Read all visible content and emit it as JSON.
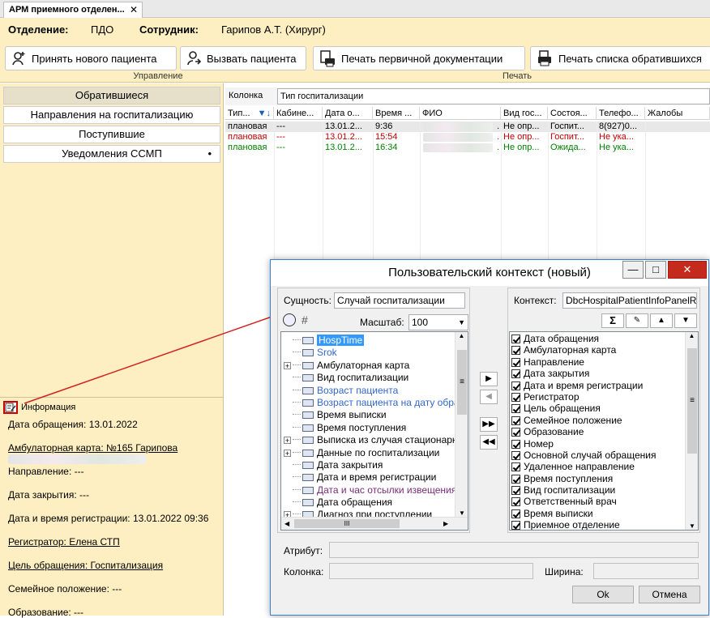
{
  "tab": {
    "title": "АРМ приемного отделен...",
    "close": "✕"
  },
  "infobar": {
    "dept_label": "Отделение:",
    "dept_value": "ПДО",
    "emp_label": "Сотрудник:",
    "emp_value": "Гарипов А.Т. (Хирург)"
  },
  "ribbon": {
    "new_patient": "Принять нового пациента",
    "call_patient": "Вызвать пациента",
    "print_primary": "Печать первичной документации",
    "print_list": "Печать списка обратившихся",
    "group_manage": "Управление",
    "group_print": "Печать"
  },
  "nav": {
    "items": [
      "Обратившиеся",
      "Направления на госпитализацию",
      "Поступившие",
      "Уведомления ССМП"
    ],
    "dot": "•"
  },
  "info": {
    "header": "Информация",
    "lines": [
      "Дата обращения: 13.01.2022",
      "Амбулаторная карта: №165 Гарипова",
      "Направление: ---",
      "Дата закрытия: ---",
      "Дата и время регистрации: 13.01.2022 09:36",
      "Регистратор: Елена  СТП",
      "Цель обращения: Госпитализация",
      "Семейное положение: ---",
      "Образование: ---"
    ]
  },
  "grid": {
    "col_label": "Колонка",
    "col_value": "Тип госпитализации",
    "headers": [
      "Тип...",
      "Кабине...",
      "Дата о...",
      "Время ...",
      "ФИО",
      "Вид гос...",
      "Состоя...",
      "Телефо...",
      "Жалобы"
    ],
    "sort_icon": "▼↓",
    "rows": [
      {
        "type": "плановая",
        "cab": "---",
        "date": "13.01.2...",
        "time": "9:36",
        "dot": ".",
        "vid": "Не опр...",
        "state": "Госпит...",
        "phone": "8(927)0...",
        "color": "#000000"
      },
      {
        "type": "плановая",
        "cab": "---",
        "date": "13.01.2...",
        "time": "15:54",
        "dot": ".",
        "vid": "Не опр...",
        "state": "Госпит...",
        "phone": "Не ука...",
        "color": "#c00000"
      },
      {
        "type": "плановая",
        "cab": "---",
        "date": "13.01.2...",
        "time": "16:34",
        "dot": ".",
        "vid": "Не опр...",
        "state": "Ожида...",
        "phone": "Не ука...",
        "color": "#008000"
      }
    ]
  },
  "dialog": {
    "title": "Пользовательский контекст (новый)",
    "min": "—",
    "max": "□",
    "close": "✕",
    "entity_label": "Сущность:",
    "entity_value": "Случай госпитализации",
    "scale_label": "Масштаб:",
    "scale_value": "100",
    "context_label": "Контекст:",
    "context_value": "DbcHospitalPatientInfoPanelRece",
    "tree": [
      {
        "text": "HospTime",
        "style": "selected",
        "expand": false
      },
      {
        "text": "Srok",
        "style": "blue",
        "expand": false
      },
      {
        "text": "Амбулаторная карта",
        "style": "normal",
        "expand": true
      },
      {
        "text": "Вид госпитализации",
        "style": "normal",
        "expand": false
      },
      {
        "text": "Возраст пациента",
        "style": "blue",
        "expand": false
      },
      {
        "text": "Возраст пациента на дату обраще",
        "style": "blue",
        "expand": false
      },
      {
        "text": "Время выписки",
        "style": "normal",
        "expand": false
      },
      {
        "text": "Время поступления",
        "style": "normal",
        "expand": false
      },
      {
        "text": "Выписка из случая стационарного",
        "style": "normal",
        "expand": true
      },
      {
        "text": "Данные по госпитализации",
        "style": "normal",
        "expand": true
      },
      {
        "text": "Дата закрытия",
        "style": "normal",
        "expand": false
      },
      {
        "text": "Дата и время регистрации",
        "style": "normal",
        "expand": false
      },
      {
        "text": "Дата и час отсылки извещения",
        "style": "purple",
        "expand": false
      },
      {
        "text": "Дата обращения",
        "style": "normal",
        "expand": false
      },
      {
        "text": "Диагноз при поступлении",
        "style": "normal",
        "expand": true
      }
    ],
    "checked": [
      "Дата обращения",
      "Амбулаторная карта",
      "Направление",
      "Дата закрытия",
      "Дата и время регистрации",
      "Регистратор",
      "Цель обращения",
      "Семейное положение",
      "Образование",
      "Номер",
      "Основной случай обращения",
      "Удаленное направление",
      "Время поступления",
      "Вид госпитализации",
      "Ответственный врач",
      "Время выписки",
      "Приемное отделение"
    ],
    "move_right": "▶",
    "move_left": "◀",
    "move_all_right": "▶▶",
    "move_all_left": "◀◀",
    "sum": "Σ",
    "up": "▲",
    "down": "▼",
    "scroll_mark": "≡",
    "scroll_h": "III",
    "attr_label": "Атрибут:",
    "col_label": "Колонка:",
    "width_label": "Ширина:",
    "ok": "Ok",
    "cancel": "Отмена"
  },
  "colors": {
    "ribbon_bg": "#fdefc1",
    "arrow": "#d32020",
    "link_blue": "#3366cc",
    "selected": "#3399ff"
  }
}
